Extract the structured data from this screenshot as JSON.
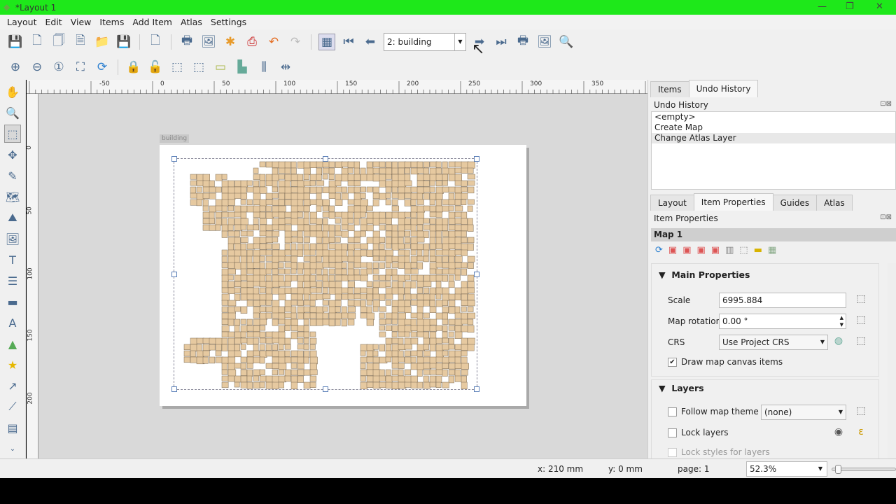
{
  "window": {
    "title": "*Layout 1"
  },
  "menu": [
    "Layout",
    "Edit",
    "View",
    "Items",
    "Add Item",
    "Atlas",
    "Settings"
  ],
  "toolbar": {
    "atlas_feature": "2: building"
  },
  "ruler_top": [
    "-50",
    "0",
    "50",
    "100",
    "150",
    "200",
    "250",
    "300",
    "350"
  ],
  "ruler_left": [
    "0",
    "50",
    "100",
    "150",
    "200"
  ],
  "canvas": {
    "page_label": "building",
    "map_fill": "#e6c9a0"
  },
  "right": {
    "top_tabs": [
      "Items",
      "Undo History"
    ],
    "undo_title": "Undo History",
    "undo_items": [
      "<empty>",
      "Create Map",
      "Change Atlas Layer"
    ],
    "bottom_tabs": [
      "Layout",
      "Item Properties",
      "Guides",
      "Atlas"
    ],
    "props_title": "Item Properties",
    "item_name": "Map 1",
    "main_props": {
      "title": "Main Properties",
      "scale_label": "Scale",
      "scale": "6995.884",
      "rotation_label": "Map rotation",
      "rotation": "0.00 °",
      "crs_label": "CRS",
      "crs": "Use Project CRS",
      "draw_canvas_items": "Draw map canvas items"
    },
    "layers": {
      "title": "Layers",
      "follow_theme": "Follow map theme",
      "theme": "(none)",
      "lock_layers": "Lock layers",
      "lock_styles": "Lock styles for layers"
    }
  },
  "status": {
    "x": "x: 210 mm",
    "y": "y: 0 mm",
    "page": "page: 1",
    "zoom": "52.3%",
    "zoom_slider": 0.05
  }
}
